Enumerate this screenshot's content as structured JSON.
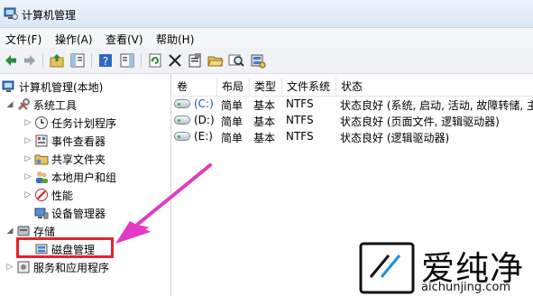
{
  "window": {
    "title": "计算机管理",
    "icon": "computer-management-icon"
  },
  "menu": [
    "文件(F)",
    "操作(A)",
    "查看(V)",
    "帮助(H)"
  ],
  "toolbar": [
    "back-icon",
    "forward-icon",
    "up-folder-icon",
    "show-hide-tree-icon",
    "help-icon",
    "properties-pane-icon",
    "refresh-icon",
    "delete-icon",
    "properties-icon",
    "open-folder-icon",
    "search-icon",
    "disk-settings-icon"
  ],
  "tree": {
    "root": "计算机管理(本地)",
    "system_tools": "系统工具",
    "items": [
      "任务计划程序",
      "事件查看器",
      "共享文件夹",
      "本地用户和组",
      "性能",
      "设备管理器"
    ],
    "storage": "存储",
    "disk_management": "磁盘管理",
    "services": "服务和应用程序"
  },
  "table": {
    "columns": [
      "卷",
      "布局",
      "类型",
      "文件系统",
      "状态"
    ],
    "rows": [
      [
        "(C:)",
        "简单",
        "基本",
        "NTFS",
        "状态良好 (系统, 启动, 活动, 故障转储, 主"
      ],
      [
        "(D:)",
        "简单",
        "基本",
        "NTFS",
        "状态良好 (页面文件, 逻辑驱动器)"
      ],
      [
        "(E:)",
        "简单",
        "基本",
        "NTFS",
        "状态良好 (逻辑驱动器)"
      ]
    ]
  },
  "watermark": {
    "text": "爱纯净",
    "url": "aichunjing.com"
  },
  "colors": {
    "highlight": "#e3242b",
    "pointer": "#e23ac4",
    "selected_volume": "#0a4fd6"
  }
}
